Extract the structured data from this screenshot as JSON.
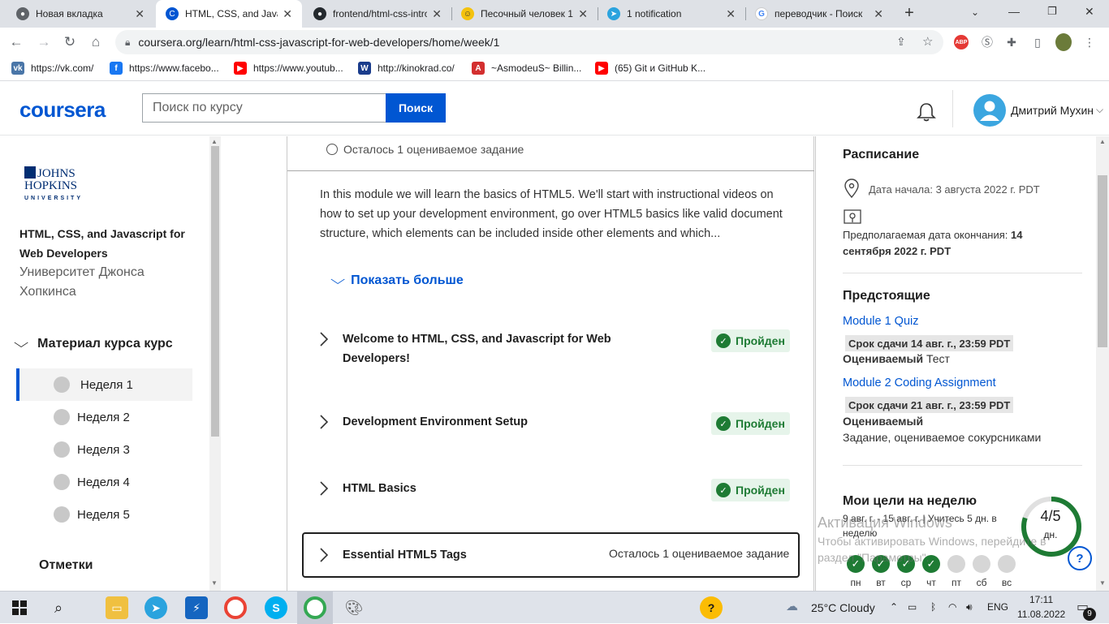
{
  "browser": {
    "tabs": [
      {
        "title": "Новая вкладка",
        "icon": "chrome-icon"
      },
      {
        "title": "HTML, CSS, and Javascript for Web",
        "icon": "coursera-icon",
        "active": true
      },
      {
        "title": "frontend/html-css-intro",
        "icon": "github-icon"
      },
      {
        "title": "Песочный человек 1",
        "icon": "emoji-icon"
      },
      {
        "title": "1 notification",
        "icon": "telegram-icon"
      },
      {
        "title": "переводчик - Поиск",
        "icon": "google-icon"
      }
    ],
    "new_tab_symbol": "+",
    "url": "coursera.org/learn/html-css-javascript-for-web-developers/home/week/1",
    "bookmarks": [
      {
        "label": "https://vk.com/",
        "color": "#4a76a8",
        "glyph": "vk"
      },
      {
        "label": "https://www.facebo...",
        "color": "#1877f2",
        "glyph": "f"
      },
      {
        "label": "https://www.youtub...",
        "color": "#ff0000",
        "glyph": "▶"
      },
      {
        "label": "http://kinokrad.co/",
        "color": "#1a3c8c",
        "glyph": "W"
      },
      {
        "label": "~AsmodeuS~ Billin...",
        "color": "#d32f2f",
        "glyph": "A"
      },
      {
        "label": "(65) Git и GitHub K...",
        "color": "#ff0000",
        "glyph": "▶"
      }
    ]
  },
  "header": {
    "logo": "coursera",
    "search_placeholder": "Поиск по курсу",
    "search_button": "Поиск",
    "user_name": "Дмитрий Мухин"
  },
  "sidebar": {
    "university_logo_lines": [
      "JOHNS",
      "HOPKINS",
      "UNIVERSITY"
    ],
    "course_title": "HTML, CSS, and Javascript for Web Developers",
    "university": "Университет Джонса Хопкинса",
    "material_label": "Материал курса курс",
    "weeks": [
      "Неделя 1",
      "Неделя 2",
      "Неделя 3",
      "Неделя 4",
      "Неделя 5"
    ],
    "selected_week": 0,
    "notes_label": "Отметки"
  },
  "main": {
    "remaining_top": "Осталось 1 оцениваемое задание",
    "description": "In this module we will learn the basics of HTML5. We'll start with instructional videos on how to set up your development environment, go over HTML5 basics like valid document structure, which elements can be included inside other elements and which...",
    "show_more": "Показать больше",
    "lessons": [
      {
        "title": "Welcome to HTML, CSS, and Javascript for Web Developers!",
        "status": "Пройден"
      },
      {
        "title": "Development Environment Setup",
        "status": "Пройден"
      },
      {
        "title": "HTML Basics",
        "status": "Пройден"
      },
      {
        "title": "Essential HTML5 Tags",
        "status": "Осталось 1 оцениваемое задание"
      }
    ]
  },
  "right": {
    "schedule_title": "Расписание",
    "start_date": "Дата начала: 3 августа 2022 г. PDT",
    "end_date_label": "Предполагаемая дата окончания:",
    "end_date_value": "14 сентября 2022 г. PDT",
    "upcoming_title": "Предстоящие",
    "upcoming": [
      {
        "link": "Module 1 Quiz",
        "due": "Срок сдачи 14 авг. г., 23:59 PDT",
        "graded": "Оцениваемый",
        "type": "Тест"
      },
      {
        "link": "Module 2 Coding Assignment",
        "due": "Срок сдачи 21 авг. г., 23:59 PDT",
        "graded": "Оцениваемый",
        "type": "Задание, оцениваемое сокурсниками"
      }
    ],
    "goals_title": "Мои цели на неделю",
    "goals_sub": "9 авг. г. - 15 авг. г. | Учитесь 5 дн. в неделю",
    "ring_value": "4/5",
    "ring_unit": "дн.",
    "ring_progress": 0.8,
    "days": [
      {
        "label": "пн",
        "done": true
      },
      {
        "label": "вт",
        "done": true
      },
      {
        "label": "ср",
        "done": true
      },
      {
        "label": "чт",
        "done": true
      },
      {
        "label": "пт",
        "done": false
      },
      {
        "label": "сб",
        "done": false
      },
      {
        "label": "вс",
        "done": false
      }
    ],
    "help": "?"
  },
  "watermark": {
    "line1": "Активация Windows",
    "line2": "Чтобы активировать Windows, перейдите в раздел \"Параметры\"."
  },
  "taskbar": {
    "weather": "25°C  Cloudy",
    "lang": "ENG",
    "time": "17:11",
    "date": "11.08.2022",
    "notifications": "9"
  },
  "colors": {
    "accent": "#0056d2",
    "success": "#1e7b34",
    "success_bg": "#e6f4ea"
  }
}
